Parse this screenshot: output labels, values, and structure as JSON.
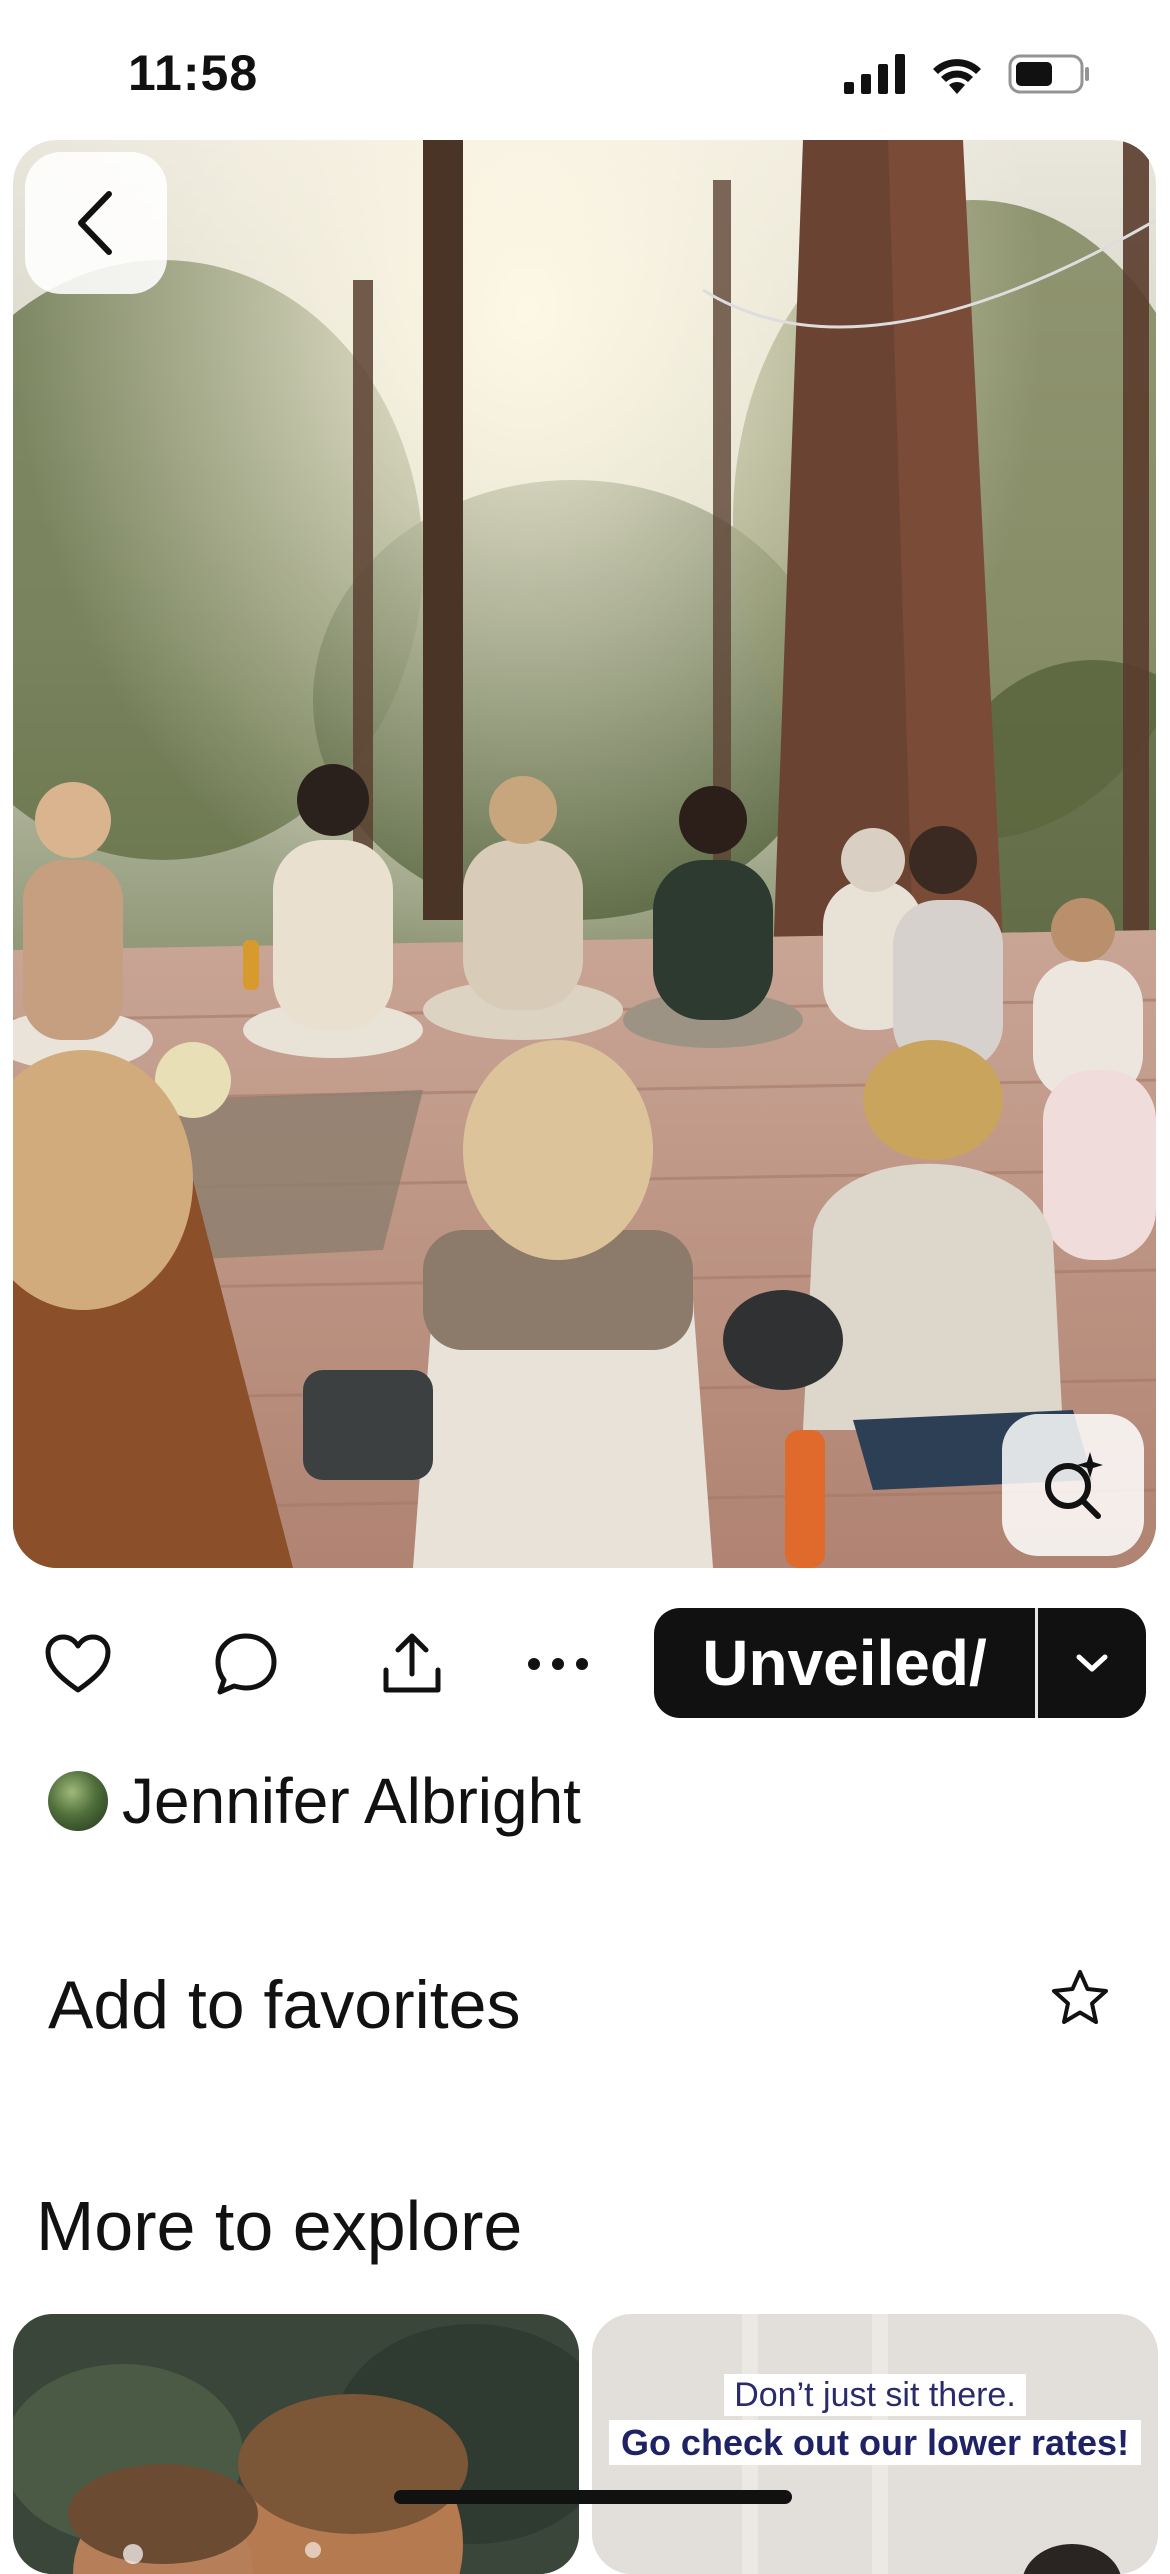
{
  "status_bar": {
    "time": "11:58"
  },
  "hero": {
    "back_icon": "chevron-left-icon",
    "lens_icon": "visual-search-icon"
  },
  "actions": {
    "icons": [
      "heart-icon",
      "comment-icon",
      "share-icon",
      "more-icon"
    ],
    "board_name": "Unveiled/",
    "board_dropdown_icon": "chevron-down-icon"
  },
  "author": {
    "name": "Jennifer Albright"
  },
  "favorites": {
    "label": "Add to favorites",
    "icon": "star-icon"
  },
  "explore": {
    "heading": "More to explore",
    "ad_line1": "Don’t just sit there.",
    "ad_line2": "Go check out our lower rates!"
  },
  "colors": {
    "pill_background": "#111111",
    "text": "#111111",
    "ad_text": "#1f2366"
  }
}
